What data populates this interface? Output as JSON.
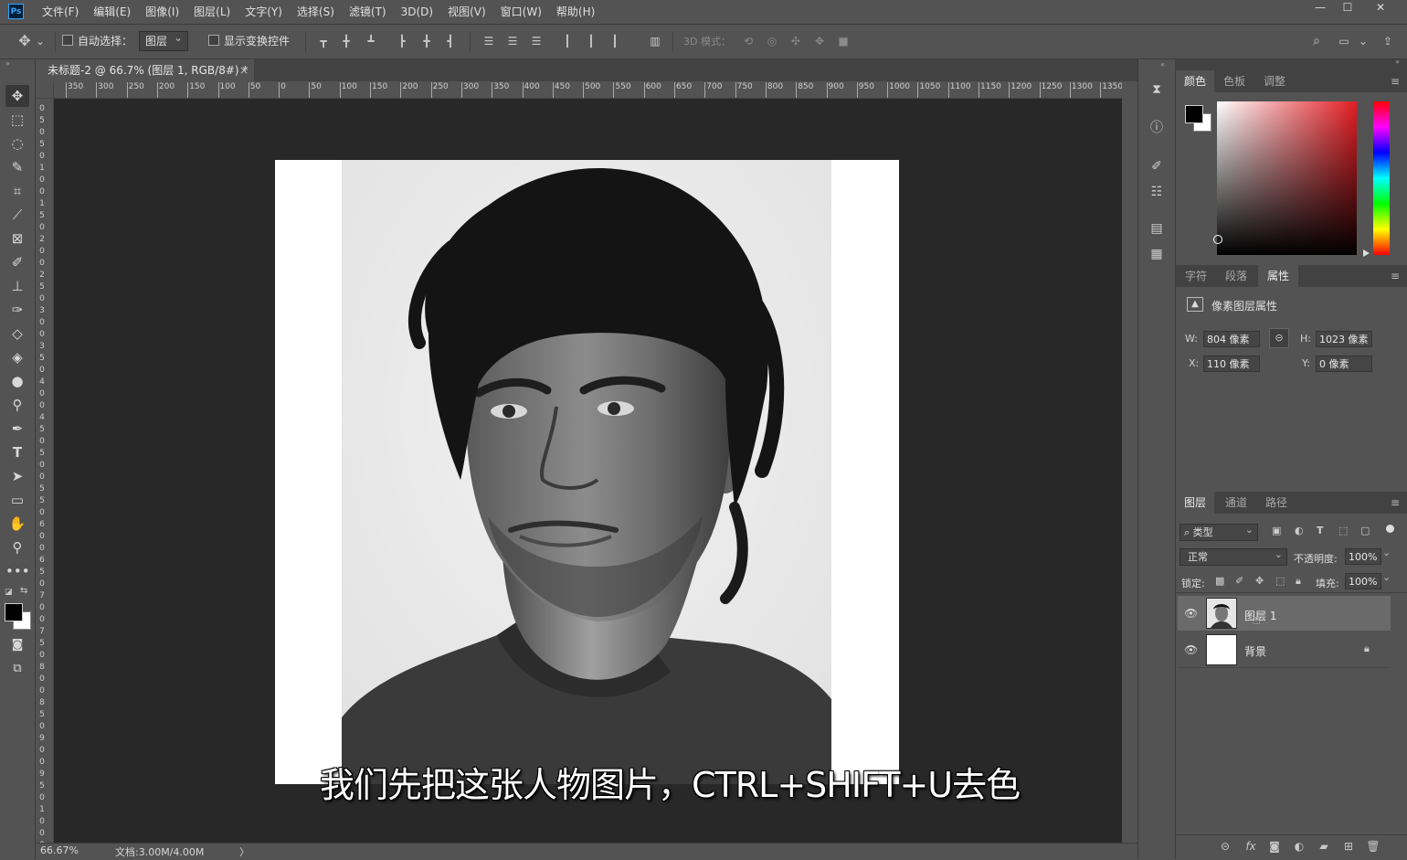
{
  "app": {
    "logo": "Ps"
  },
  "menu": [
    "文件(F)",
    "编辑(E)",
    "图像(I)",
    "图层(L)",
    "文字(Y)",
    "选择(S)",
    "滤镜(T)",
    "3D(D)",
    "视图(V)",
    "窗口(W)",
    "帮助(H)"
  ],
  "window_controls": {
    "minimize": "—",
    "maximize": "☐",
    "close": "✕"
  },
  "options": {
    "auto_select_label": "自动选择：",
    "auto_select_value": "图层",
    "show_transform_label": "显示变换控件",
    "mode_3d_label": "3D 模式："
  },
  "document_tab": {
    "title": "未标题-2 @ 66.7% (图层 1, RGB/8#) *",
    "close": "×"
  },
  "ruler": {
    "h_labels": [
      "350",
      "300",
      "250",
      "200",
      "150",
      "100",
      "50",
      "0",
      "50",
      "100",
      "150",
      "200",
      "250",
      "300",
      "350",
      "400",
      "450",
      "500",
      "550",
      "600",
      "650",
      "700",
      "750",
      "800",
      "850",
      "900",
      "950",
      "1000",
      "1050",
      "1100",
      "1150",
      "1200",
      "1250",
      "1300",
      "1350"
    ],
    "v_labels": [
      "0",
      "5",
      "0",
      "5",
      "0",
      "1",
      "0",
      "0",
      "1",
      "5",
      "0",
      "2",
      "0",
      "0",
      "2",
      "5",
      "0",
      "3",
      "0",
      "0",
      "3",
      "5",
      "0",
      "4",
      "0",
      "0",
      "4",
      "5",
      "0",
      "5",
      "0",
      "0",
      "5",
      "5",
      "0",
      "6",
      "0",
      "0",
      "6",
      "5",
      "0",
      "7",
      "0",
      "0",
      "7",
      "5",
      "0",
      "8",
      "0",
      "0",
      "8",
      "5",
      "0",
      "9",
      "0",
      "0",
      "9",
      "5",
      "0",
      "1",
      "0",
      "0",
      "0"
    ]
  },
  "subtitle": "我们先把这张人物图片，CTRL+SHIFT+U去色",
  "status": {
    "zoom": "66.67%",
    "doc_size": "文档:3.00M/4.00M",
    "arrow": "〉"
  },
  "color_panel": {
    "tabs": [
      "颜色",
      "色板",
      "调整"
    ],
    "active_tab": "颜色",
    "foreground": "#000000",
    "background": "#ffffff",
    "hue_base": "#e31e24"
  },
  "properties_panel": {
    "tabs": [
      "字符",
      "段落",
      "属性"
    ],
    "active_tab": "属性",
    "header": "像素图层属性",
    "w_label": "W:",
    "w_value": "804 像素",
    "h_label": "H:",
    "h_value": "1023 像素",
    "x_label": "X:",
    "x_value": "110 像素",
    "y_label": "Y:",
    "y_value": "0 像素"
  },
  "layers_panel": {
    "tabs": [
      "图层",
      "通道",
      "路径"
    ],
    "active_tab": "图层",
    "filter_value": "类型",
    "blend_mode": "正常",
    "opacity_label": "不透明度:",
    "opacity_value": "100%",
    "lock_label": "锁定:",
    "fill_label": "填充:",
    "fill_value": "100%",
    "layers": [
      {
        "name": "图层 1",
        "selected": true
      },
      {
        "name": "背景",
        "selected": false,
        "locked": true
      }
    ]
  },
  "panel_menu_glyph": "≡",
  "icons": {
    "move": "move-icon",
    "marquee": "marquee-icon",
    "lasso": "lasso-icon",
    "quick_select": "quick-select-icon",
    "crop": "crop-icon",
    "eyedropper": "eyedropper-icon",
    "frame": "frame-icon",
    "brush": "brush-icon",
    "stamp": "stamp-icon",
    "history_brush": "history-brush-icon",
    "eraser": "eraser-icon",
    "bucket": "bucket-icon",
    "blur": "blur-icon",
    "dodge": "dodge-icon",
    "pen": "pen-icon",
    "type": "type-icon",
    "path_select": "path-select-icon",
    "shape": "shape-icon",
    "hand": "hand-icon",
    "zoom": "zoom-icon"
  }
}
